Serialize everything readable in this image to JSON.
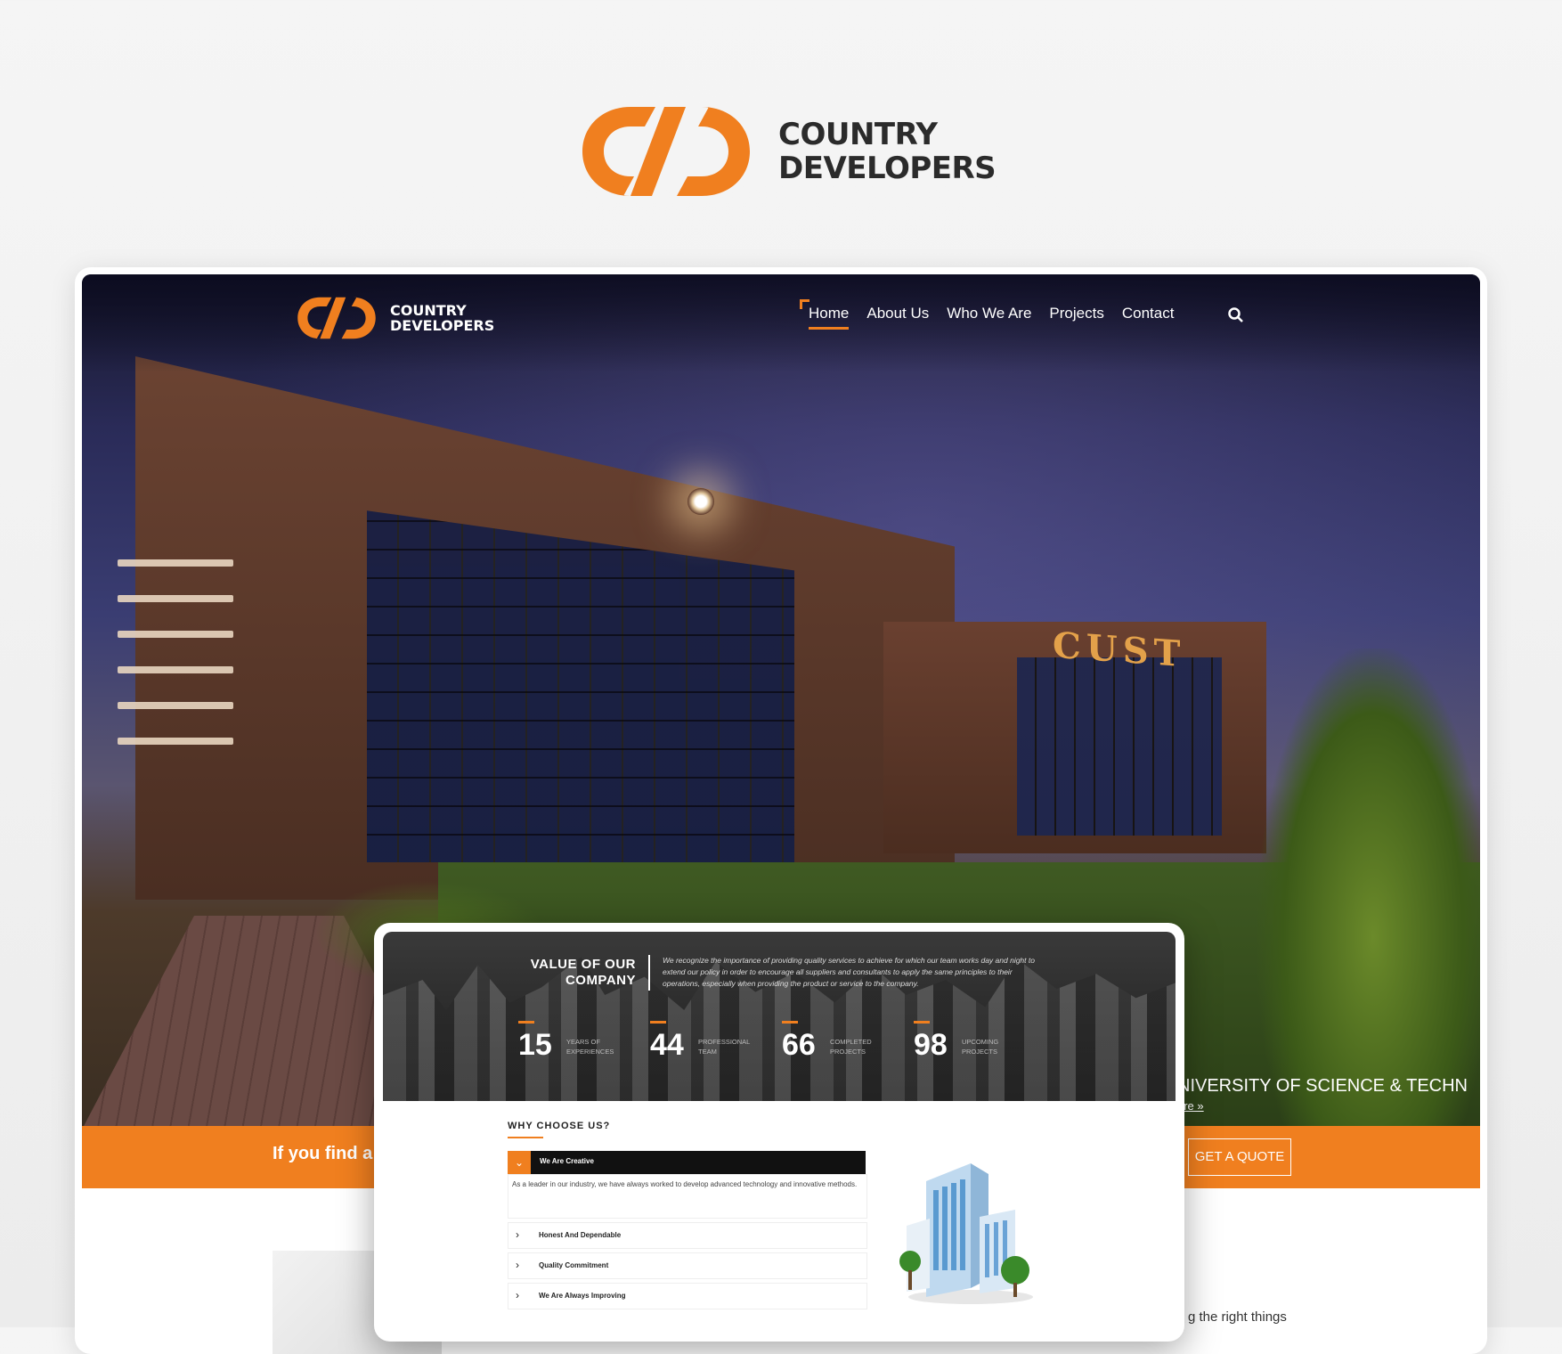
{
  "brand": {
    "line1": "COUNTRY",
    "line2": "DEVELOPERS"
  },
  "colors": {
    "accent": "#f07f1f",
    "dark": "#2b2b2b"
  },
  "header": {
    "logo_line1": "COUNTRY",
    "logo_line2": "DEVELOPERS",
    "nav": [
      "Home",
      "About Us",
      "Who We Are",
      "Projects",
      "Contact"
    ],
    "active_nav": "Home",
    "search_icon": "search-icon"
  },
  "hero": {
    "sign_text": "CUST",
    "caption": "NIVERSITY OF SCIENCE & TECHN",
    "link": "ore »"
  },
  "banner": {
    "text": "If you find a",
    "button": "GET A QUOTE"
  },
  "below": {
    "text": "g the right things"
  },
  "company_value": {
    "title": "VALUE OF OUR COMPANY",
    "description": "We recognize the importance of providing quality services to achieve for which our team works day and night to extend our policy in order to encourage all suppliers and consultants to apply the same principles to their operations, especially when providing the product or service to the company.",
    "stats": [
      {
        "value": "15",
        "label": "YEARS OF EXPERIENCES"
      },
      {
        "value": "44",
        "label": "PROFESSIONAL TEAM"
      },
      {
        "value": "66",
        "label": "COMPLETED PROJECTS"
      },
      {
        "value": "98",
        "label": "UPCOMING PROJECTS"
      }
    ]
  },
  "why_choose": {
    "title": "WHY CHOOSE US?",
    "open_item": {
      "title": "We Are Creative",
      "body": "As a leader in our industry, we have always worked to develop advanced technology and innovative methods."
    },
    "items": [
      "Honest And Dependable",
      "Quality Commitment",
      "We Are Always Improving"
    ]
  }
}
